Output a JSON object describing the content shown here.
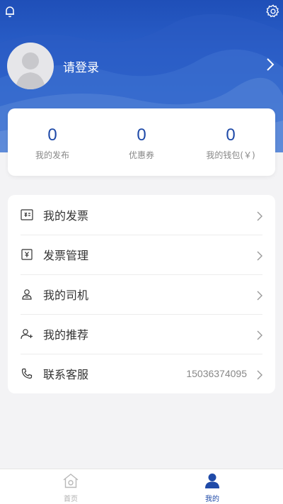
{
  "header": {
    "login_text": "请登录",
    "colors": {
      "primary": "#1f4aa8",
      "header_bg": "#2a5fc9"
    }
  },
  "stats": [
    {
      "value": "0",
      "label": "我的发布"
    },
    {
      "value": "0",
      "label": "优惠券"
    },
    {
      "value": "0",
      "label": "我的钱包(￥)"
    }
  ],
  "menu": [
    {
      "label": "我的发票",
      "icon": "invoice-icon"
    },
    {
      "label": "发票管理",
      "icon": "invoice-manage-icon"
    },
    {
      "label": "我的司机",
      "icon": "driver-icon"
    },
    {
      "label": "我的推荐",
      "icon": "add-user-icon"
    },
    {
      "label": "联系客服",
      "icon": "phone-icon",
      "value": "15036374095"
    }
  ],
  "tabbar": {
    "tabs": [
      {
        "label": "首页",
        "icon": "home-icon",
        "active": false
      },
      {
        "label": "我的",
        "icon": "user-icon",
        "active": true
      }
    ]
  }
}
